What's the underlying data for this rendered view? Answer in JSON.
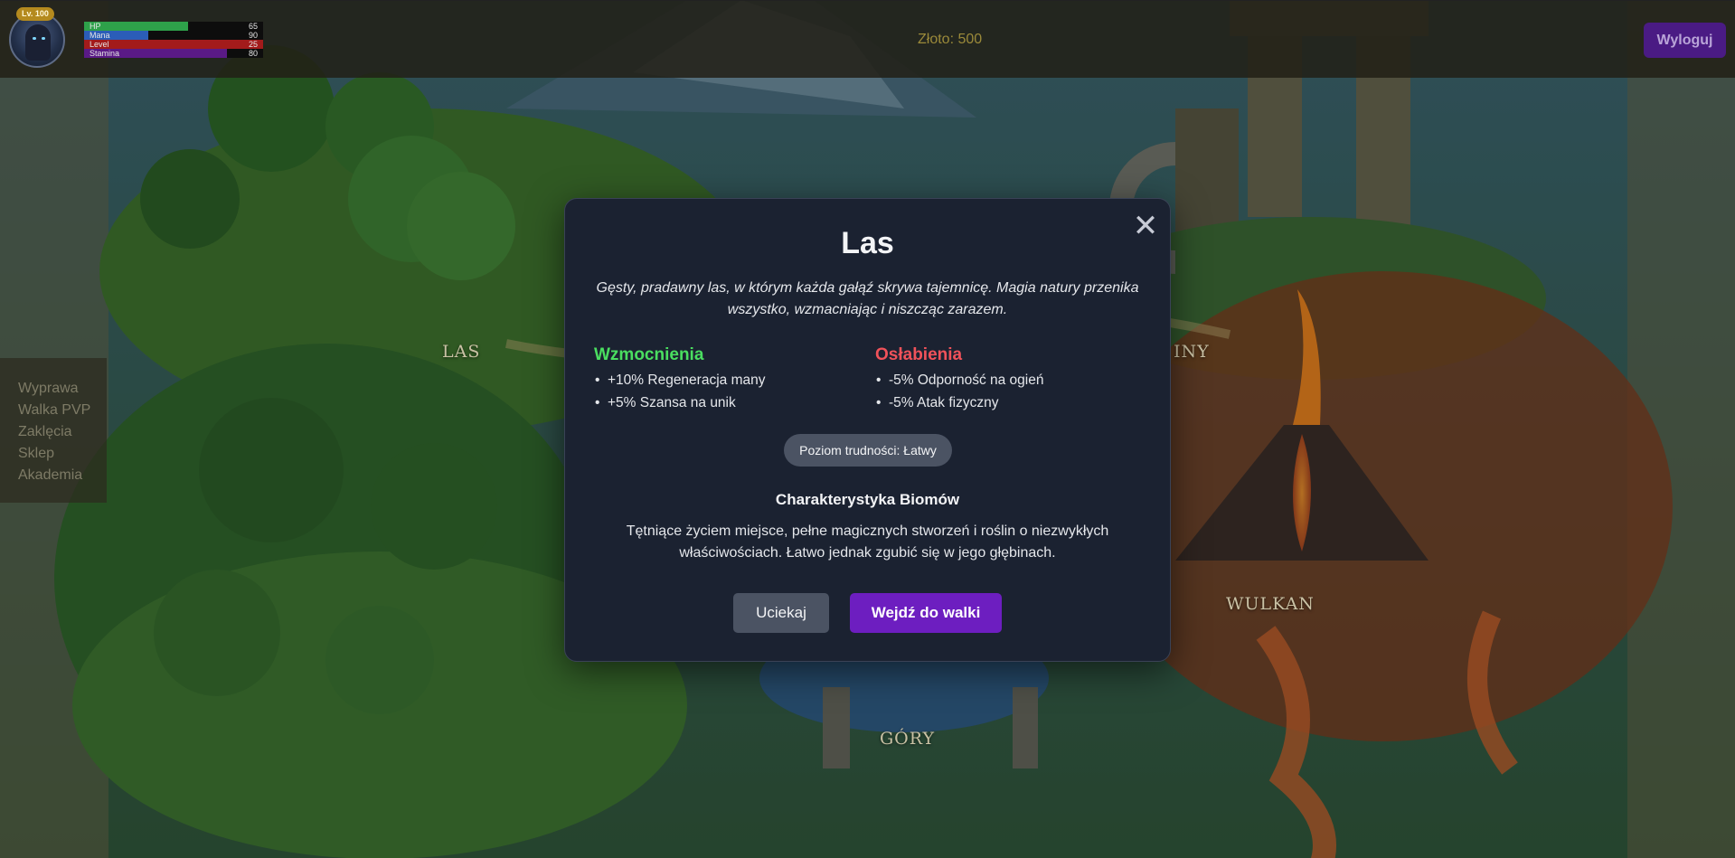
{
  "player": {
    "level_badge": "Lv. 100",
    "stats": [
      {
        "label": "HP",
        "value": "65",
        "fill": 0.58,
        "color": "#2ea14a"
      },
      {
        "label": "Mana",
        "value": "90",
        "fill": 0.36,
        "color": "#2b5db8"
      },
      {
        "label": "Level",
        "value": "25",
        "fill": 1.0,
        "color": "#a31b1b"
      },
      {
        "label": "Stamina",
        "value": "80",
        "fill": 0.8,
        "color": "#5a1a86"
      }
    ]
  },
  "header": {
    "gold": "Złoto: 500",
    "logout_label": "Wyloguj"
  },
  "sidebar": {
    "items": [
      {
        "label": "Wyprawa"
      },
      {
        "label": "Walka PVP"
      },
      {
        "label": "Zaklęcia"
      },
      {
        "label": "Sklep"
      },
      {
        "label": "Akademia"
      }
    ]
  },
  "map": {
    "regions": [
      {
        "label": "LAS"
      },
      {
        "label": "INY"
      },
      {
        "label": "WULKAN"
      },
      {
        "label": "GÓRY"
      }
    ]
  },
  "modal": {
    "title": "Las",
    "close_icon": "close-icon",
    "description": "Gęsty, pradawny las, w którym każda gałąź skrywa tajemnicę. Magia natury przenika wszystko, wzmacniając i niszcząc zarazem.",
    "buffs": {
      "heading": "Wzmocnienia",
      "items": [
        "+10% Regeneracja many",
        "+5% Szansa na unik"
      ]
    },
    "debuffs": {
      "heading": "Osłabienia",
      "items": [
        "-5% Odporność na ogień",
        "-5% Atak fizyczny"
      ]
    },
    "difficulty": "Poziom trudności: Łatwy",
    "subheading": "Charakterystyka Biomów",
    "text": "Tętniące życiem miejsce, pełne magicznych stworzeń i roślin o niezwykłych właściwościach. Łatwo jednak zgubić się w jego głębinach.",
    "flee_label": "Uciekaj",
    "fight_label": "Wejdź do walki"
  }
}
